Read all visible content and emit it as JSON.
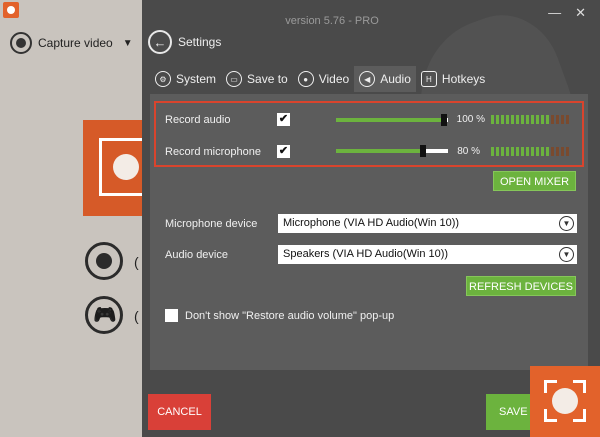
{
  "app": {
    "version": "version 5.76 - PRO",
    "capture_label": "Capture video",
    "paren_glyph": "("
  },
  "window": {
    "minimize": "—",
    "close": "✕"
  },
  "header": {
    "back_label": "Settings"
  },
  "tabs": [
    {
      "label": "System",
      "icon": "gears-icon"
    },
    {
      "label": "Save to",
      "icon": "folder-icon"
    },
    {
      "label": "Video",
      "icon": "record-icon"
    },
    {
      "label": "Audio",
      "icon": "speaker-icon",
      "active": true
    },
    {
      "label": "Hotkeys",
      "icon": "hotkey-icon"
    }
  ],
  "audio": {
    "record_audio": {
      "label": "Record audio",
      "checked": true,
      "percent_label": "100 %",
      "level": 1.0
    },
    "record_mic": {
      "label": "Record microphone",
      "checked": true,
      "percent_label": "80 %",
      "level": 0.8
    },
    "open_mixer": "OPEN MIXER",
    "mic_device_label": "Microphone device",
    "mic_device_value": "Microphone (VIA HD Audio(Win 10))",
    "audio_device_label": "Audio device",
    "audio_device_value": "Speakers (VIA HD Audio(Win 10))",
    "refresh_devices": "REFRESH DEVICES",
    "restore_popup_label": "Don't show \"Restore audio volume\" pop-up",
    "restore_popup_checked": false
  },
  "footer": {
    "cancel": "CANCEL",
    "save": "SAVE"
  },
  "colors": {
    "accent_green": "#6cb33e",
    "accent_red": "#d94038",
    "brand_orange": "#e2622b"
  }
}
